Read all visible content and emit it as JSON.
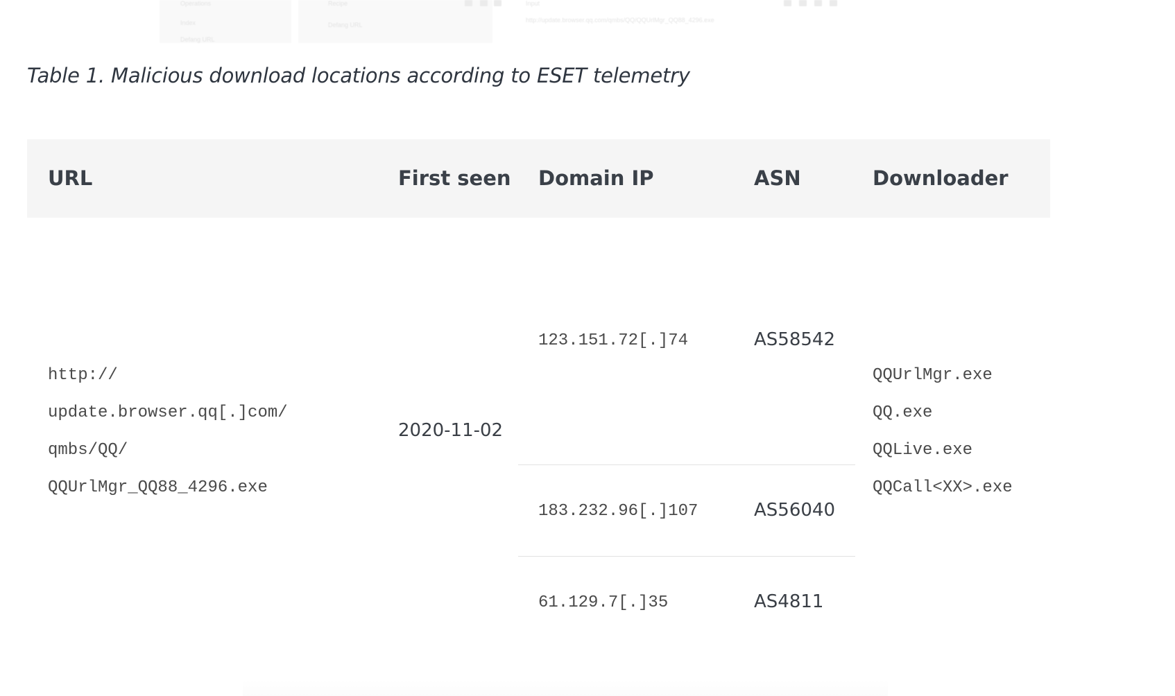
{
  "background_ui": {
    "panel_operations": "Operations",
    "panel_recipe": "Recipe",
    "panel_input": "Input",
    "item_index": "Index",
    "item_defang": "Defang URL",
    "item_selected": "Defang URL",
    "input_url": "http://update.browser.qq.com/qmbs/QQ/QQUrlMgr_QQ88_4296.exe"
  },
  "caption": "Table 1. Malicious download locations according to ESET telemetry",
  "table": {
    "headers": {
      "url": "URL",
      "first_seen": "First seen",
      "domain_ip": "Domain IP",
      "asn": "ASN",
      "downloader": "Downloader"
    },
    "url_lines": [
      "http://",
      "update.browser.qq[.]com/",
      "qmbs/QQ/",
      "QQUrlMgr_QQ88_4296.exe"
    ],
    "first_seen": "2020-11-02",
    "ip_rows": [
      {
        "ip": "123.151.72[.]74",
        "asn": "AS58542"
      },
      {
        "ip": "183.232.96[.]107",
        "asn": "AS56040"
      },
      {
        "ip": "61.129.7[.]35",
        "asn": "AS4811"
      }
    ],
    "downloaders": [
      "QQUrlMgr.exe",
      "QQ.exe",
      "QQLive.exe",
      "QQCall<XX>.exe"
    ]
  }
}
